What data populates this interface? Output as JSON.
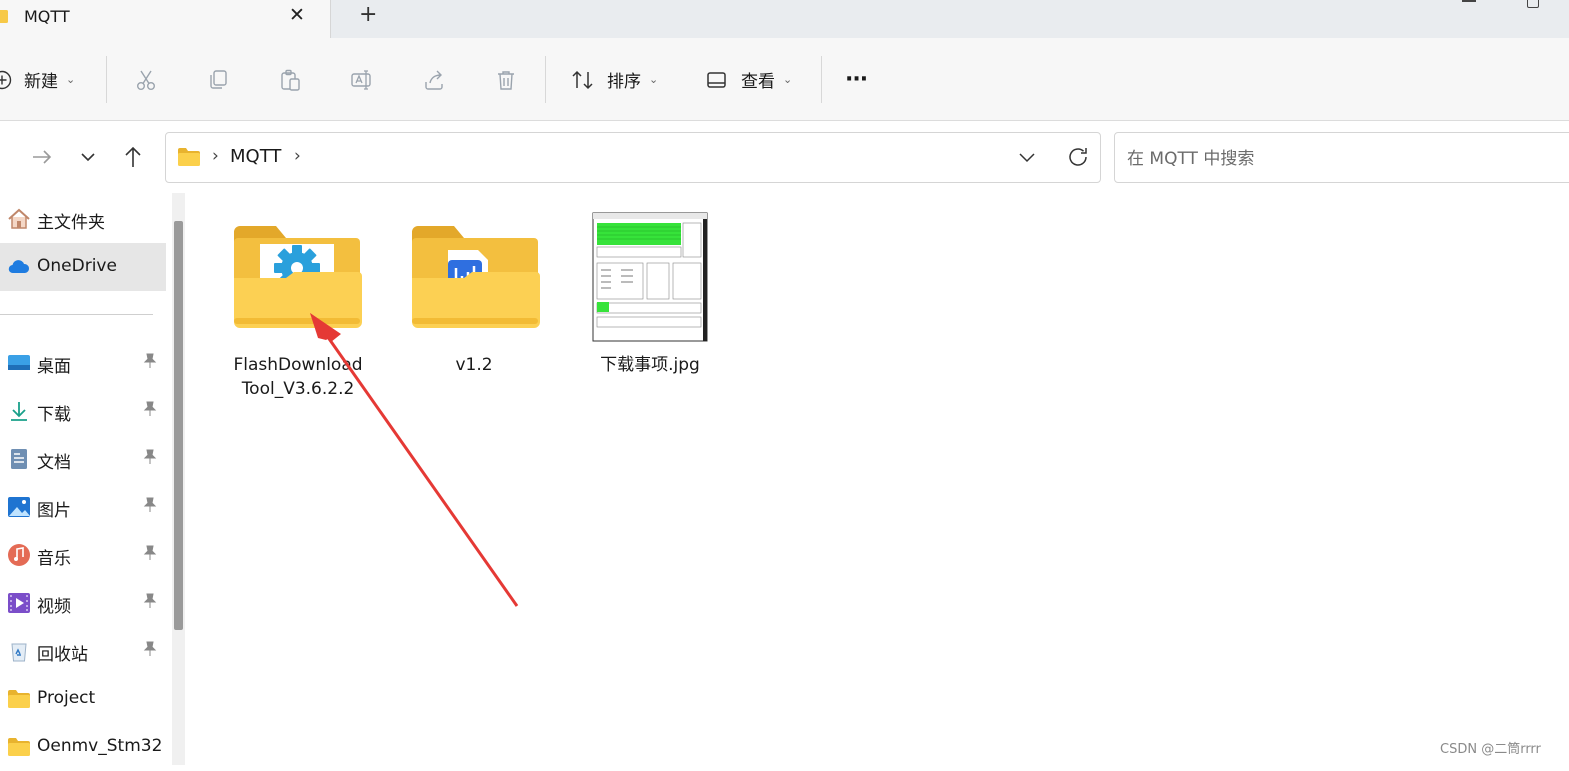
{
  "tab": {
    "title": "MQTT",
    "close": "✕",
    "add": "+"
  },
  "toolbar": {
    "new_label": "新建",
    "sort_label": "排序",
    "view_label": "查看",
    "more": "···",
    "caret": "⌄"
  },
  "address": {
    "separator": "›",
    "path": "MQTT"
  },
  "search": {
    "placeholder": "在 MQTT 中搜索"
  },
  "sidebar": {
    "items": [
      {
        "label": "主文件夹",
        "icon": "home-icon"
      },
      {
        "label": "OneDrive",
        "icon": "cloud-icon",
        "selected": true
      },
      {
        "label": "桌面",
        "icon": "desktop-icon",
        "pinned": true
      },
      {
        "label": "下载",
        "icon": "download-icon",
        "pinned": true
      },
      {
        "label": "文档",
        "icon": "document-icon",
        "pinned": true
      },
      {
        "label": "图片",
        "icon": "picture-icon",
        "pinned": true
      },
      {
        "label": "音乐",
        "icon": "music-icon",
        "pinned": true
      },
      {
        "label": "视频",
        "icon": "video-icon",
        "pinned": true
      },
      {
        "label": "回收站",
        "icon": "recycle-bin-icon",
        "pinned": true
      },
      {
        "label": "Project",
        "icon": "folder-icon"
      },
      {
        "label": "Oenmv_Stm32",
        "icon": "folder-icon"
      }
    ],
    "pin": "📌"
  },
  "files": [
    {
      "name": "FlashDownloadTool_V3.6.2.2",
      "type": "folder"
    },
    {
      "name": "v1.2",
      "type": "folder"
    },
    {
      "name": "下载事项.jpg",
      "type": "image"
    }
  ],
  "watermark": "CSDN @二筒rrrr",
  "colors": {
    "folder": "#f7c948",
    "folder_front": "#fcd34d",
    "accent": "#0078d4",
    "arrow": "#e53935"
  }
}
